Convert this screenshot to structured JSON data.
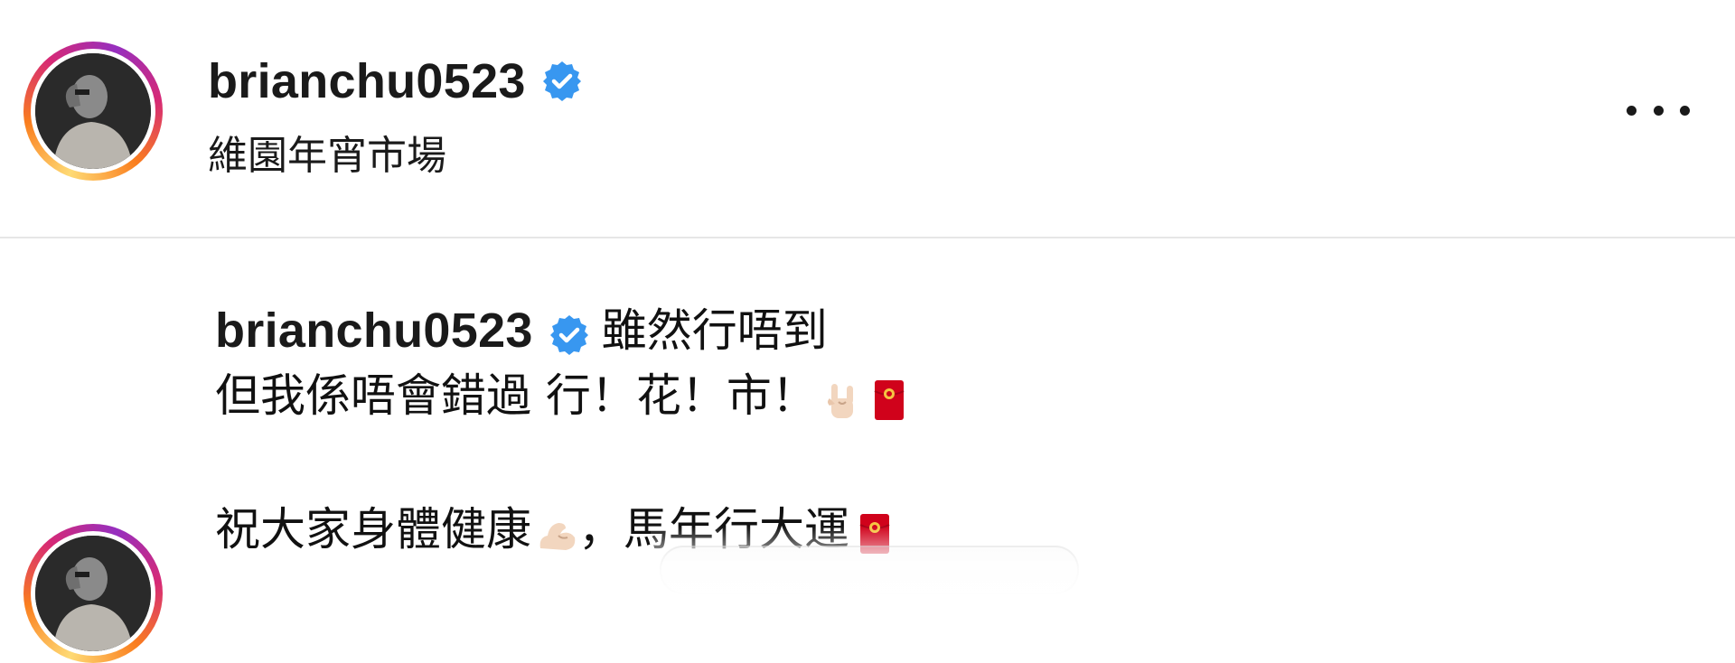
{
  "post_header": {
    "username": "brianchu0523",
    "location": "維園年宵市場",
    "verified": true
  },
  "comment": {
    "username": "brianchu0523",
    "verified": true,
    "lines": [
      {
        "text": "雖然行唔到"
      },
      {
        "text": "但我係唔會錯過 行！花！市！"
      },
      {
        "text": "祝大家身體健康"
      },
      {
        "text": "，馬年行大運"
      }
    ]
  },
  "colors": {
    "verified_blue": "#3897f0",
    "text": "#1a1a1a",
    "divider": "#e6e6e6",
    "red_envelope": "#d0021b"
  },
  "icons": {
    "verified": "verified-badge-icon",
    "more": "more-options-icon",
    "rock_hand": "sign-of-horns-emoji",
    "red_envelope": "red-envelope-emoji",
    "muscle": "flexed-biceps-emoji"
  }
}
